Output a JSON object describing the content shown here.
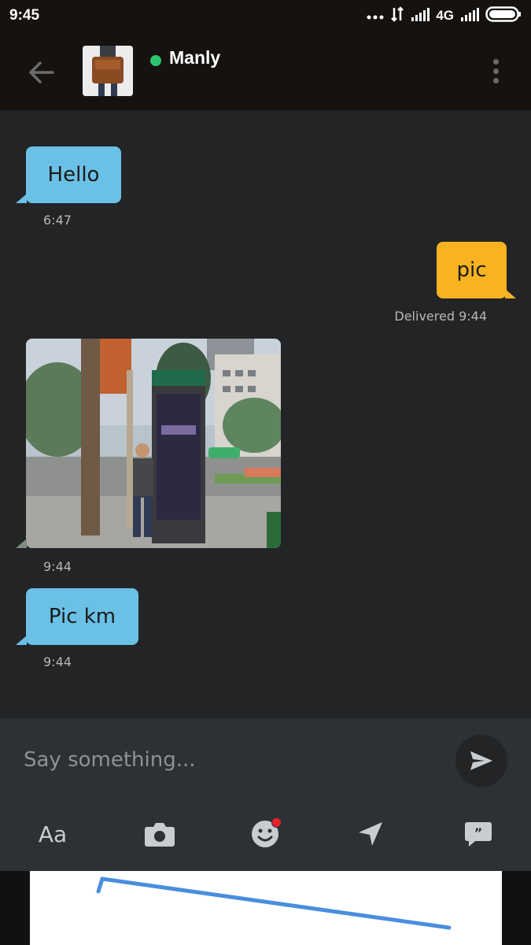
{
  "status_bar": {
    "time": "9:45",
    "network": "4G",
    "icons": [
      "dots-icon",
      "data-arrows-icon",
      "signal-icon",
      "battery-icon"
    ]
  },
  "header": {
    "contact_name": "Manly",
    "online": true,
    "online_color": "#2bc56e",
    "back_icon": "arrow-left-icon",
    "menu_icon": "more-vertical-icon"
  },
  "messages": [
    {
      "direction": "incoming",
      "text": "Hello",
      "time": "6:47"
    },
    {
      "direction": "outgoing",
      "text": "pic",
      "status": "Delivered 9:44"
    },
    {
      "direction": "incoming",
      "type": "photo",
      "time": "9:44"
    },
    {
      "direction": "incoming",
      "text": "Pic km",
      "time": "9:44"
    }
  ],
  "composer": {
    "placeholder": "Say something...",
    "send_icon": "send-icon",
    "tools": [
      {
        "name": "text-format",
        "label": "Aa"
      },
      {
        "name": "camera-icon"
      },
      {
        "name": "sticker-icon",
        "has_badge": true
      },
      {
        "name": "location-icon"
      },
      {
        "name": "phrases-icon"
      }
    ]
  },
  "colors": {
    "incoming_bubble": "#6bc0e5",
    "outgoing_bubble": "#f7b321",
    "chat_background": "#222426",
    "composer_background": "#2d3034",
    "badge": "#e8202c"
  }
}
